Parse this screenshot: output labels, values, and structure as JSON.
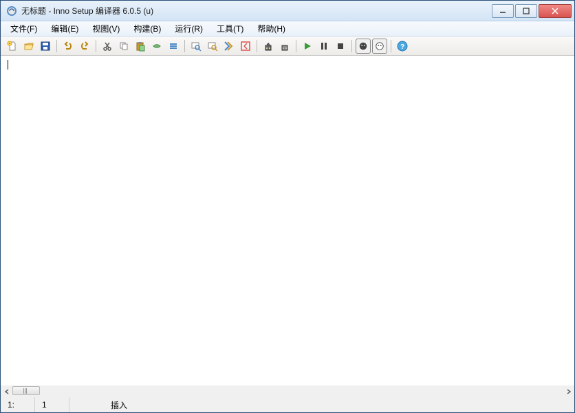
{
  "titlebar": {
    "title": "无标题 - Inno Setup 编译器 6.0.5 (u)"
  },
  "menu": {
    "file": "文件(F)",
    "edit": "编辑(E)",
    "view": "视图(V)",
    "build": "构建(B)",
    "run": "运行(R)",
    "tools": "工具(T)",
    "help": "帮助(H)"
  },
  "status": {
    "line": "1:",
    "col": "1",
    "mode": "插入"
  }
}
